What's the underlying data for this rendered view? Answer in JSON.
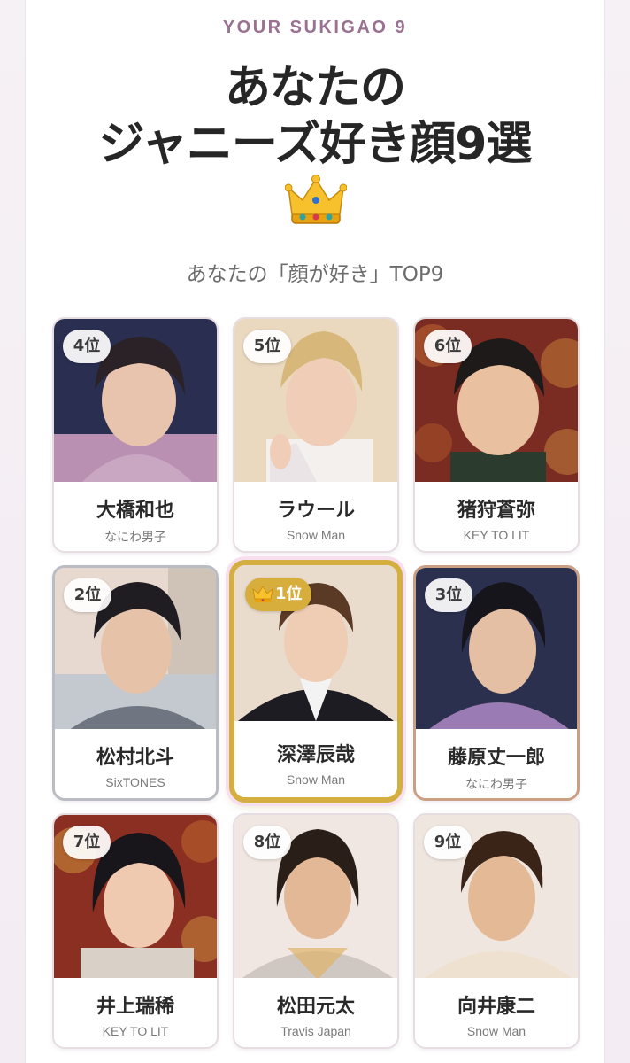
{
  "header": {
    "eyebrow": "YOUR SUKIGAO 9",
    "title_line1": "あなたの",
    "title_line2": "ジャニーズ好き顔9選",
    "crown_icon": "crown-icon",
    "subtitle": "あなたの「顔が好き」TOP9"
  },
  "colors": {
    "accent_eyebrow": "#9a7191",
    "gold": "#d4ae3e",
    "silver": "#b9bcc3",
    "bronze": "#c9a084"
  },
  "grid": [
    {
      "rank": "4位",
      "name": "大橋和也",
      "group": "なにわ男子"
    },
    {
      "rank": "5位",
      "name": "ラウール",
      "group": "Snow Man"
    },
    {
      "rank": "6位",
      "name": "猪狩蒼弥",
      "group": "KEY TO LIT"
    },
    {
      "rank": "2位",
      "name": "松村北斗",
      "group": "SixTONES"
    },
    {
      "rank": "1位",
      "name": "深澤辰哉",
      "group": "Snow Man"
    },
    {
      "rank": "3位",
      "name": "藤原丈一郎",
      "group": "なにわ男子"
    },
    {
      "rank": "7位",
      "name": "井上瑞稀",
      "group": "KEY TO LIT"
    },
    {
      "rank": "8位",
      "name": "松田元太",
      "group": "Travis Japan"
    },
    {
      "rank": "9位",
      "name": "向井康二",
      "group": "Snow Man"
    }
  ]
}
